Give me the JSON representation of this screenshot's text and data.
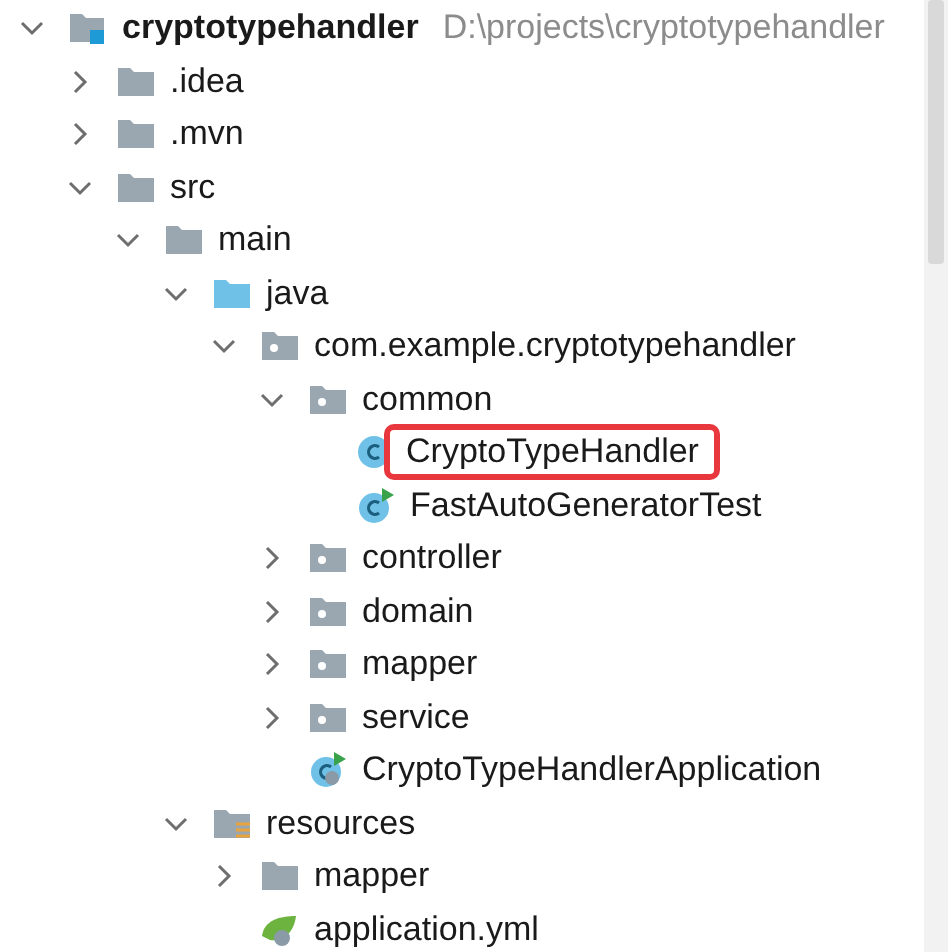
{
  "project_tree": [
    {
      "label": "cryptotypehandler",
      "path": "D:\\projects\\cryptotypehandler",
      "kind": "module",
      "expanded": true,
      "children": [
        {
          "label": ".idea",
          "kind": "folder",
          "expanded": false
        },
        {
          "label": ".mvn",
          "kind": "folder",
          "expanded": false
        },
        {
          "label": "src",
          "kind": "folder",
          "expanded": true,
          "children": [
            {
              "label": "main",
              "kind": "folder",
              "expanded": true,
              "children": [
                {
                  "label": "java",
                  "kind": "source-folder",
                  "expanded": true,
                  "children": [
                    {
                      "label": "com.example.cryptotypehandler",
                      "kind": "package",
                      "expanded": true,
                      "children": [
                        {
                          "label": "common",
                          "kind": "package",
                          "expanded": true,
                          "children": [
                            {
                              "label": "CryptoTypeHandler",
                              "kind": "class",
                              "highlighted": true
                            },
                            {
                              "label": "FastAutoGeneratorTest",
                              "kind": "test-class",
                              "highlighted": false
                            }
                          ]
                        },
                        {
                          "label": "controller",
                          "kind": "package",
                          "expanded": false
                        },
                        {
                          "label": "domain",
                          "kind": "package",
                          "expanded": false
                        },
                        {
                          "label": "mapper",
                          "kind": "package",
                          "expanded": false
                        },
                        {
                          "label": "service",
                          "kind": "package",
                          "expanded": false
                        },
                        {
                          "label": "CryptoTypeHandlerApplication",
                          "kind": "app-class"
                        }
                      ]
                    }
                  ]
                },
                {
                  "label": "resources",
                  "kind": "resources-folder",
                  "expanded": true,
                  "children": [
                    {
                      "label": "mapper",
                      "kind": "folder",
                      "expanded": false
                    },
                    {
                      "label": "application.yml",
                      "kind": "yml"
                    }
                  ]
                }
              ]
            }
          ]
        }
      ]
    }
  ]
}
